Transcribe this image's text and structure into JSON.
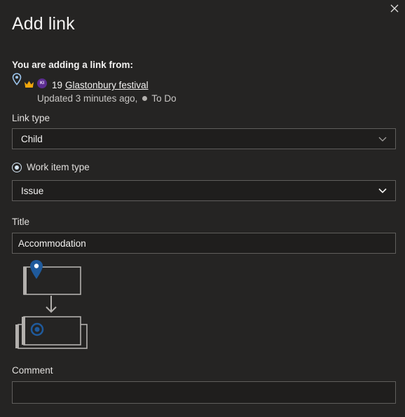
{
  "dialog": {
    "title": "Add link",
    "close_icon": "close-icon"
  },
  "source": {
    "heading": "You are adding a link from:",
    "icons": [
      "map-pin-icon",
      "crown-icon"
    ],
    "avatar_initials": "KI",
    "item_id": "19",
    "item_title": "Glastonbury festival",
    "updated": "Updated 3 minutes ago,",
    "state": "To Do"
  },
  "link_type": {
    "label": "Link type",
    "value": "Child"
  },
  "work_item_type": {
    "label": "Work item type",
    "value": "Issue"
  },
  "title_field": {
    "label": "Title",
    "value": "Accommodation"
  },
  "comment": {
    "label": "Comment",
    "value": ""
  },
  "colors": {
    "background": "#252423",
    "input_background": "#1f1e1d",
    "border": "#605e5c",
    "accent_blue": "#1f5a9c",
    "avatar": "#5c2d91",
    "crown": "#f2a60c"
  }
}
